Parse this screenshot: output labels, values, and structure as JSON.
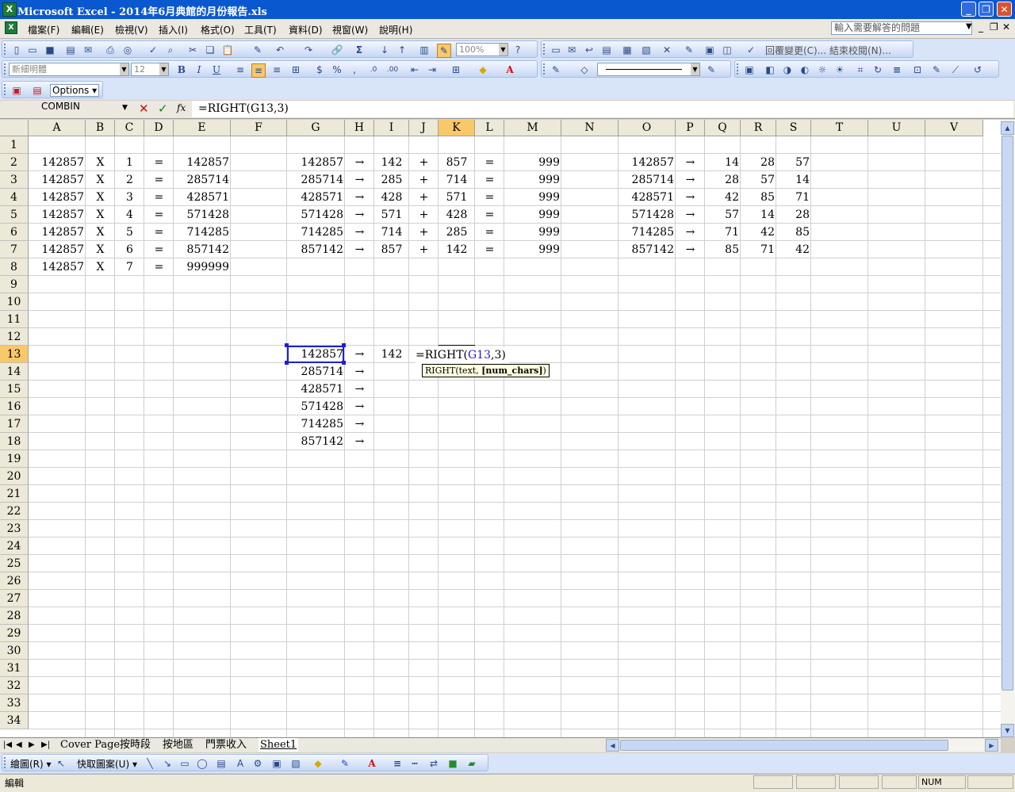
{
  "window": {
    "title": "Microsoft Excel - 2014年6月典館的月份報告.xls",
    "icon": "excel-icon",
    "minimize": "_",
    "restore": "❐",
    "close": "✕"
  },
  "menu": {
    "items": [
      "檔案(F)",
      "編輯(E)",
      "檢視(V)",
      "插入(I)",
      "格式(O)",
      "工具(T)",
      "資料(D)",
      "視窗(W)",
      "說明(H)"
    ],
    "help_placeholder": "輸入需要解答的問題"
  },
  "toolbar": {
    "zoom": "100%",
    "font_name": "新細明體",
    "font_size": "12",
    "reviewing": "回覆變更(C)... 結束校閱(N)...",
    "options": "Options"
  },
  "formula_bar": {
    "name_box": "COMBIN",
    "cancel": "✕",
    "enter": "✓",
    "fx": "fx",
    "formula": "=RIGHT(G13,3)"
  },
  "grid": {
    "columns": [
      "A",
      "B",
      "C",
      "D",
      "E",
      "F",
      "G",
      "H",
      "I",
      "J",
      "K",
      "L",
      "M",
      "N",
      "O",
      "P",
      "Q",
      "R",
      "S",
      "T",
      "U",
      "V"
    ],
    "selected_column": "K",
    "selected_row": "13",
    "rows": [
      "1",
      "2",
      "3",
      "4",
      "5",
      "6",
      "7",
      "8",
      "9",
      "10",
      "11",
      "12",
      "13",
      "14",
      "15",
      "16",
      "17",
      "18",
      "19",
      "20",
      "21",
      "22",
      "23",
      "24",
      "25",
      "26",
      "27",
      "28",
      "29",
      "30",
      "31",
      "32",
      "33",
      "34"
    ],
    "table1": [
      [
        "142857",
        "X",
        "1",
        "=",
        "142857"
      ],
      [
        "142857",
        "X",
        "2",
        "=",
        "285714"
      ],
      [
        "142857",
        "X",
        "3",
        "=",
        "428571"
      ],
      [
        "142857",
        "X",
        "4",
        "=",
        "571428"
      ],
      [
        "142857",
        "X",
        "5",
        "=",
        "714285"
      ],
      [
        "142857",
        "X",
        "6",
        "=",
        "857142"
      ],
      [
        "142857",
        "X",
        "7",
        "=",
        "999999"
      ]
    ],
    "table2": [
      [
        "142857",
        "→",
        "142",
        "+",
        "857",
        "=",
        "999"
      ],
      [
        "285714",
        "→",
        "285",
        "+",
        "714",
        "=",
        "999"
      ],
      [
        "428571",
        "→",
        "428",
        "+",
        "571",
        "=",
        "999"
      ],
      [
        "571428",
        "→",
        "571",
        "+",
        "428",
        "=",
        "999"
      ],
      [
        "714285",
        "→",
        "714",
        "+",
        "285",
        "=",
        "999"
      ],
      [
        "857142",
        "→",
        "857",
        "+",
        "142",
        "=",
        "999"
      ]
    ],
    "table3": [
      [
        "142857",
        "→",
        "14",
        "28",
        "57"
      ],
      [
        "285714",
        "→",
        "28",
        "57",
        "14"
      ],
      [
        "428571",
        "→",
        "42",
        "85",
        "71"
      ],
      [
        "571428",
        "→",
        "57",
        "14",
        "28"
      ],
      [
        "714285",
        "→",
        "71",
        "42",
        "85"
      ],
      [
        "857142",
        "→",
        "85",
        "71",
        "42"
      ]
    ],
    "table4": [
      [
        "142857",
        "→",
        "142"
      ],
      [
        "285714",
        "→",
        ""
      ],
      [
        "428571",
        "→",
        ""
      ],
      [
        "571428",
        "→",
        ""
      ],
      [
        "714285",
        "→",
        ""
      ],
      [
        "857142",
        "→",
        ""
      ]
    ],
    "editing_formula_prefix": "=RIGHT(",
    "editing_formula_ref": "G13",
    "editing_formula_suffix": ",3)",
    "tooltip_func": "RIGHT(text, ",
    "tooltip_arg": "[num_chars]",
    "tooltip_end": ")"
  },
  "sheet_tabs": [
    "Cover Page",
    "按時段",
    "按地區",
    "門票收入",
    "Sheet1"
  ],
  "active_tab": "Sheet1",
  "draw_toolbar": {
    "draw": "繪圖(R)",
    "autoshapes": "快取圖案(U)"
  },
  "status": {
    "mode": "編輯",
    "num": "NUM"
  },
  "colors": {
    "title_bar": "#0a58d0",
    "toolbar": "#d8e4f8",
    "selected_header": "#f8c86a",
    "selection_border": "#1f1fd0",
    "formula_ref": "#1f1fd0"
  }
}
